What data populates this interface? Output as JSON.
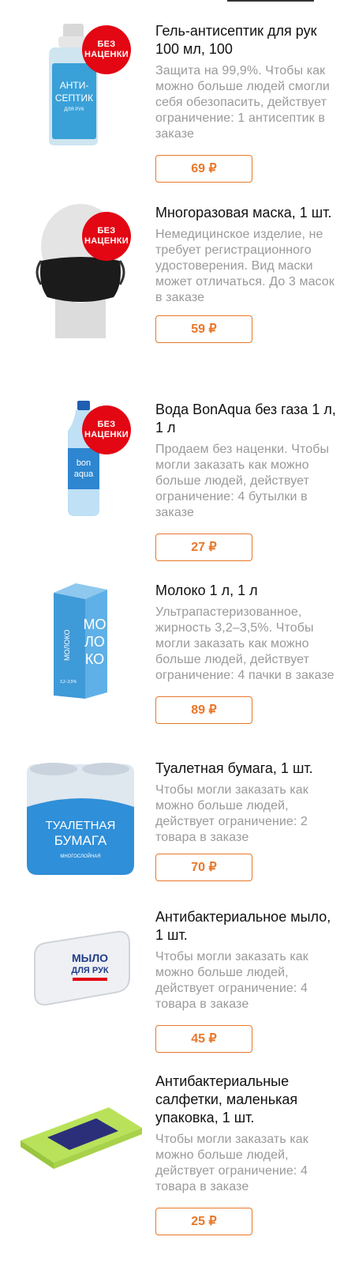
{
  "badge_text": "БЕЗ\nНАЦЕНКИ",
  "accent_color": "#e8782a",
  "badge_color": "#e30613",
  "products": [
    {
      "title": " Гель-антисептик для рук 100 мл, 100",
      "description": "Защита на 99,9%. Чтобы как можно больше людей смогли себя обезопасить, действует ограничение: 1 антисептик в заказе",
      "price": "69 ₽",
      "image_icon": "sanitizer-bottle-icon",
      "image_text": [
        "АНТИ-",
        "СЕПТИК",
        "ДЛЯ РУК"
      ],
      "badge": true
    },
    {
      "title": "Многоразовая маска, 1 шт.",
      "description": "Немедицинское изделие, не требует регистрационного удостоверения. Вид маски может отличаться. До 3 масок в заказе",
      "price": "59 ₽",
      "image_icon": "face-mask-icon",
      "badge": true
    },
    {
      "title": "Вода BonAqua без газа 1 л, 1 л",
      "description": "Продаем без наценки. Чтобы могли заказать как можно больше людей, действует ограничение: 4 бутылки в заказе",
      "price": "27 ₽",
      "image_icon": "water-bottle-icon",
      "image_text": [
        "bon",
        "aqua"
      ],
      "badge": true
    },
    {
      "title": "Молоко 1 л, 1 л",
      "description": "Ультрапастеризованное, жирность 3,2–3,5%. Чтобы могли заказать как можно больше людей, действует ограничение: 4 пачки в заказе",
      "price": "89 ₽",
      "image_icon": "milk-carton-icon",
      "image_text": [
        "МО",
        "ЛО",
        "КО",
        "МОЛОКО",
        "3,2–3,5%"
      ],
      "badge": false
    },
    {
      "title": "Туалетная бумага, 1 шт.",
      "description": "Чтобы могли заказать как можно больше людей, действует ограничение: 2 товара в заказе",
      "price": "70 ₽",
      "image_icon": "toilet-paper-icon",
      "image_text": [
        "ТУАЛЕТНАЯ",
        "БУМАГА",
        "МНОГОСЛОЙНАЯ"
      ],
      "badge": false
    },
    {
      "title": "Антибактериальное мыло, 1 шт.",
      "description": "Чтобы могли заказать как можно больше людей, действует ограничение: 4 товара в заказе",
      "price": "45 ₽",
      "image_icon": "soap-bar-icon",
      "image_text": [
        "МЫЛО",
        "ДЛЯ РУК"
      ],
      "badge": false
    },
    {
      "title": "Антибактериальные салфетки, маленькая упаковка, 1 шт.",
      "description": "Чтобы могли заказать как можно больше людей, действует ограничение: 4 товара в заказе",
      "price": "25 ₽",
      "image_icon": "wet-wipes-icon",
      "badge": false
    }
  ]
}
